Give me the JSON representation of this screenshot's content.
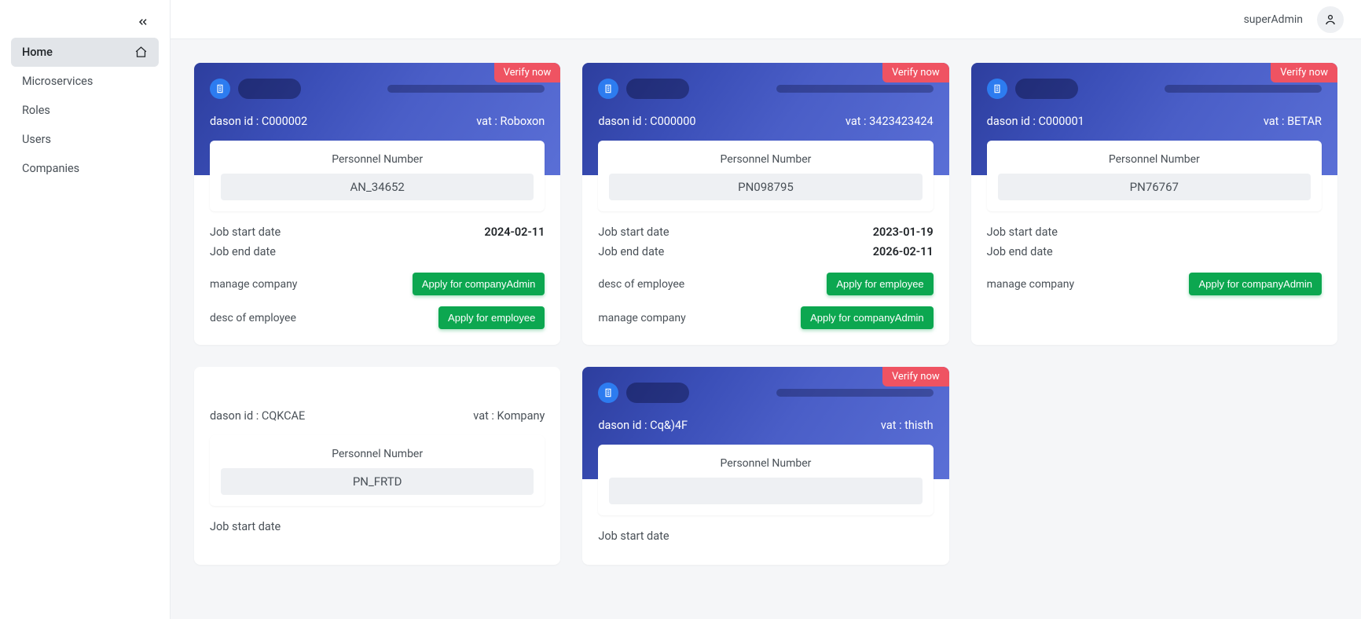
{
  "header": {
    "user": "superAdmin"
  },
  "sidebar": {
    "items": [
      {
        "label": "Home",
        "active": true,
        "icon": "home"
      },
      {
        "label": "Microservices"
      },
      {
        "label": "Roles"
      },
      {
        "label": "Users"
      },
      {
        "label": "Companies"
      }
    ]
  },
  "labels": {
    "verify_now": "Verify now",
    "dason_prefix": "dason id : ",
    "vat_prefix": "vat : ",
    "personnel_number": "Personnel Number",
    "job_start": "Job start date",
    "job_end": "Job end date",
    "manage_company": "manage company",
    "desc_employee": "desc of employee",
    "apply_company_admin": "Apply for companyAdmin",
    "apply_employee": "Apply for employee"
  },
  "cards": [
    {
      "verified": false,
      "dason_id": "C000002",
      "vat": "Roboxon",
      "personnel_number": "AN_34652",
      "job_start": "2024-02-11",
      "job_end": "",
      "actions": [
        {
          "label_key": "manage_company",
          "button_key": "apply_company_admin"
        },
        {
          "label_key": "desc_employee",
          "button_key": "apply_employee"
        }
      ]
    },
    {
      "verified": false,
      "dason_id": "C000000",
      "vat": "3423423424",
      "personnel_number": "PN098795",
      "job_start": "2023-01-19",
      "job_end": "2026-02-11",
      "actions": [
        {
          "label_key": "desc_employee",
          "button_key": "apply_employee"
        },
        {
          "label_key": "manage_company",
          "button_key": "apply_company_admin"
        }
      ]
    },
    {
      "verified": false,
      "dason_id": "C000001",
      "vat": "BETAR",
      "personnel_number": "PN76767",
      "job_start": "",
      "job_end": "",
      "actions": [
        {
          "label_key": "manage_company",
          "button_key": "apply_company_admin"
        }
      ]
    },
    {
      "verified": true,
      "dason_id": "CQKCAE",
      "vat": "Kompany",
      "personnel_number": "PN_FRTD",
      "job_start": "",
      "job_end": "",
      "actions": []
    },
    {
      "verified": false,
      "dason_id": "Cq&)4F",
      "vat": "thisth",
      "personnel_number": "",
      "job_start": "",
      "job_end": "",
      "actions": []
    }
  ]
}
